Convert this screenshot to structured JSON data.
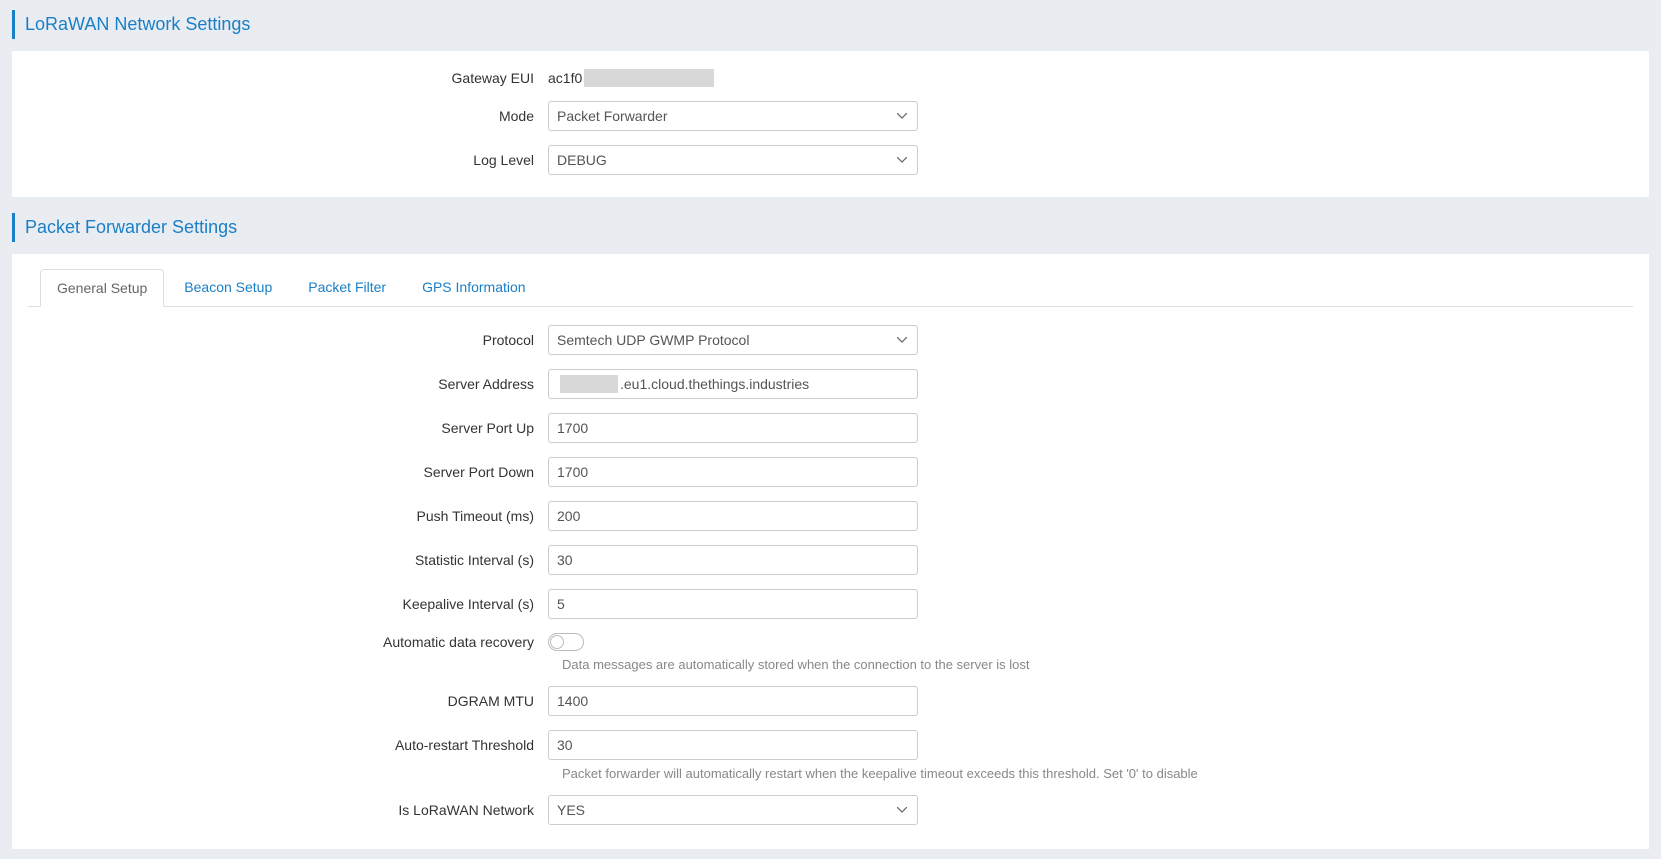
{
  "sections": {
    "network": {
      "title": "LoRaWAN Network Settings",
      "gatewayEui": {
        "label": "Gateway EUI",
        "valuePrefix": "ac1f0"
      },
      "mode": {
        "label": "Mode",
        "value": "Packet Forwarder"
      },
      "logLevel": {
        "label": "Log Level",
        "value": "DEBUG"
      }
    },
    "forwarder": {
      "title": "Packet Forwarder Settings",
      "tabs": [
        {
          "label": "General Setup",
          "active": true
        },
        {
          "label": "Beacon Setup",
          "active": false
        },
        {
          "label": "Packet Filter",
          "active": false
        },
        {
          "label": "GPS Information",
          "active": false
        }
      ],
      "protocol": {
        "label": "Protocol",
        "value": "Semtech UDP GWMP Protocol"
      },
      "serverAddress": {
        "label": "Server Address",
        "valueSuffix": ".eu1.cloud.thethings.industries"
      },
      "serverPortUp": {
        "label": "Server Port Up",
        "value": "1700"
      },
      "serverPortDown": {
        "label": "Server Port Down",
        "value": "1700"
      },
      "pushTimeout": {
        "label": "Push Timeout (ms)",
        "value": "200"
      },
      "statisticInterval": {
        "label": "Statistic Interval (s)",
        "value": "30"
      },
      "keepaliveInterval": {
        "label": "Keepalive Interval (s)",
        "value": "5"
      },
      "autoRecovery": {
        "label": "Automatic data recovery",
        "help": "Data messages are automatically stored when the connection to the server is lost"
      },
      "dgramMtu": {
        "label": "DGRAM MTU",
        "value": "1400"
      },
      "autoRestart": {
        "label": "Auto-restart Threshold",
        "value": "30",
        "help": "Packet forwarder will automatically restart when the keepalive timeout exceeds this threshold. Set '0' to disable"
      },
      "isLorawan": {
        "label": "Is LoRaWAN Network",
        "value": "YES"
      }
    }
  }
}
